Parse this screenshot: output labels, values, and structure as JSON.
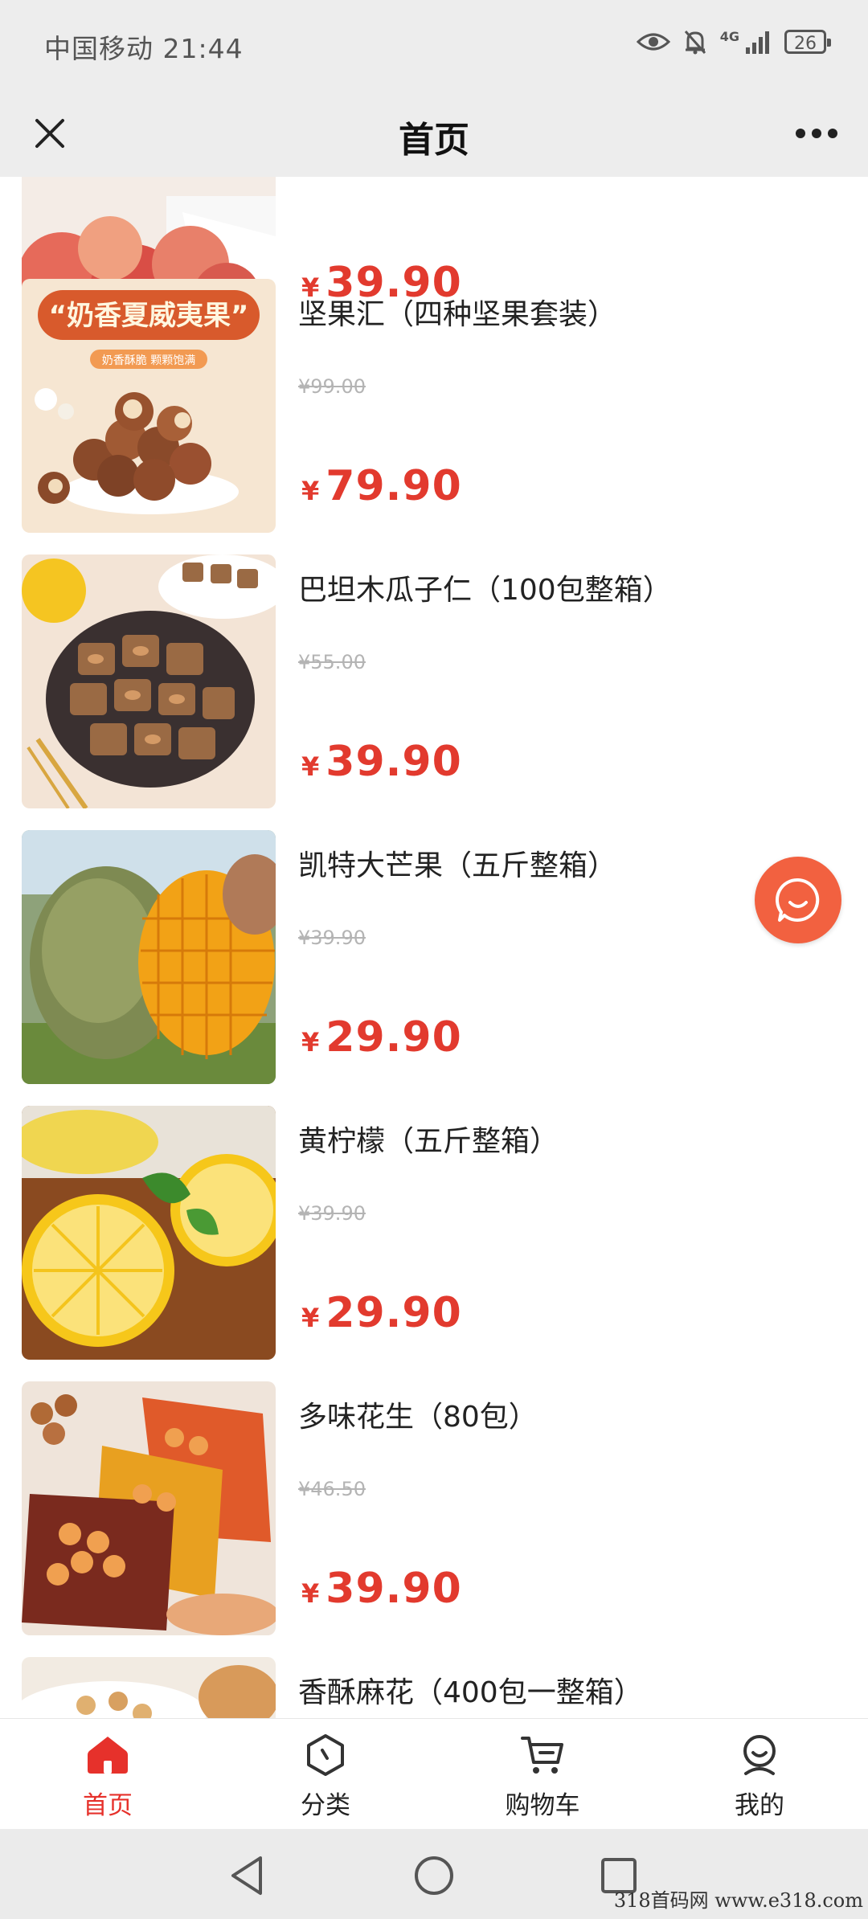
{
  "status_bar": {
    "carrier_time": "中国移动 21:44",
    "network": "4G",
    "battery": "26",
    "icons": [
      "eye-icon",
      "bell-off-icon",
      "signal-icon",
      "battery-icon"
    ]
  },
  "nav": {
    "title": "首页",
    "close_icon": "close-icon",
    "more_icon": "more-dots-icon"
  },
  "products": [
    {
      "name": "",
      "orig_price": "",
      "currency": "¥",
      "price": "39.90",
      "image": "peaches"
    },
    {
      "name": "坚果汇（四种坚果套装）",
      "orig_price": "¥99.00",
      "currency": "¥",
      "price": "79.90",
      "image": "macadamia-nuts",
      "banner_text": "“奶香夏威夷果”",
      "banner_sub": "奶香酥脆 颗颗饱满"
    },
    {
      "name": "巴坦木瓜子仁（100包整箱）",
      "orig_price": "¥55.00",
      "currency": "¥",
      "price": "39.90",
      "image": "almond-crisps"
    },
    {
      "name": "凯特大芒果（五斤整箱）",
      "orig_price": "¥39.90",
      "currency": "¥",
      "price": "29.90",
      "image": "mango"
    },
    {
      "name": "黄柠檬（五斤整箱）",
      "orig_price": "¥39.90",
      "currency": "¥",
      "price": "29.90",
      "image": "lemons"
    },
    {
      "name": "多味花生（80包）",
      "orig_price": "¥46.50",
      "currency": "¥",
      "price": "39.90",
      "image": "peanut-packs"
    },
    {
      "name": "香酥麻花（400包一整箱）",
      "orig_price": "",
      "currency": "¥",
      "price": "",
      "image": "mahua-twists"
    }
  ],
  "chat_fab_icon": "chat-bubble-icon",
  "tabbar": {
    "items": [
      {
        "label": "首页",
        "icon": "home-icon",
        "active": true
      },
      {
        "label": "分类",
        "icon": "category-icon",
        "active": false
      },
      {
        "label": "购物车",
        "icon": "cart-icon",
        "active": false
      },
      {
        "label": "我的",
        "icon": "profile-icon",
        "active": false
      }
    ]
  },
  "system_nav": {
    "icons": [
      "back-triangle-icon",
      "home-circle-icon",
      "recents-square-icon"
    ]
  },
  "watermark": "318首码网  www.e318.com"
}
